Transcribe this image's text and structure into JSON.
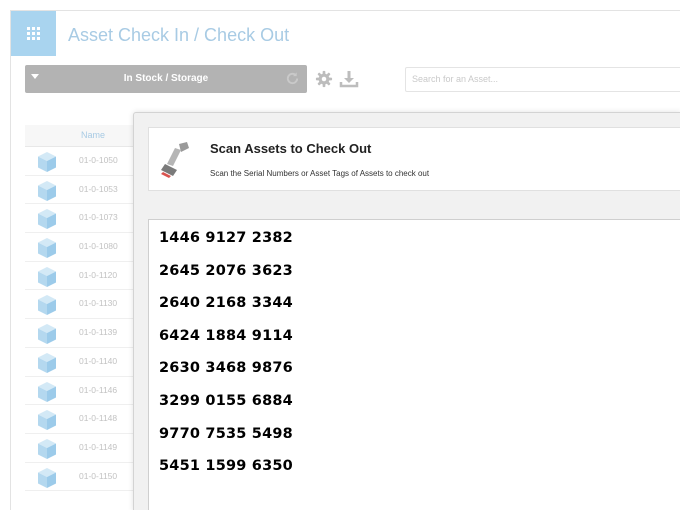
{
  "header": {
    "title": "Asset Check In / Check Out",
    "app_icon": "grid-icon"
  },
  "toolbar": {
    "location_value": "In Stock / Storage",
    "refresh_icon": "refresh-icon",
    "settings_icon": "gear-icon",
    "download_icon": "download-icon",
    "search_placeholder": "Search for an Asset..."
  },
  "table": {
    "column_name": "Name",
    "rows": [
      "01-0-1050",
      "01-0-1053",
      "01-0-1073",
      "01-0-1080",
      "01-0-1120",
      "01-0-1130",
      "01-0-1139",
      "01-0-1140",
      "01-0-1146",
      "01-0-1148",
      "01-0-1149",
      "01-0-1150"
    ]
  },
  "modal": {
    "icon": "barcode-scanner-icon",
    "title": "Scan Assets to Check Out",
    "subtitle": "Scan the Serial Numbers or Asset Tags of Assets to check out",
    "scanned": [
      "1446 9127 2382",
      "2645 2076 3623",
      "2640 2168 3344",
      "6424 1884 9114",
      "2630 3468 9876",
      "3299 0155 6884",
      "9770 7535 5498",
      "5451 1599 6350"
    ]
  },
  "colors": {
    "accent_light": "#a8cbe4",
    "app_icon_bg": "#a9d4ef",
    "select_bg": "#b3b3b3"
  }
}
